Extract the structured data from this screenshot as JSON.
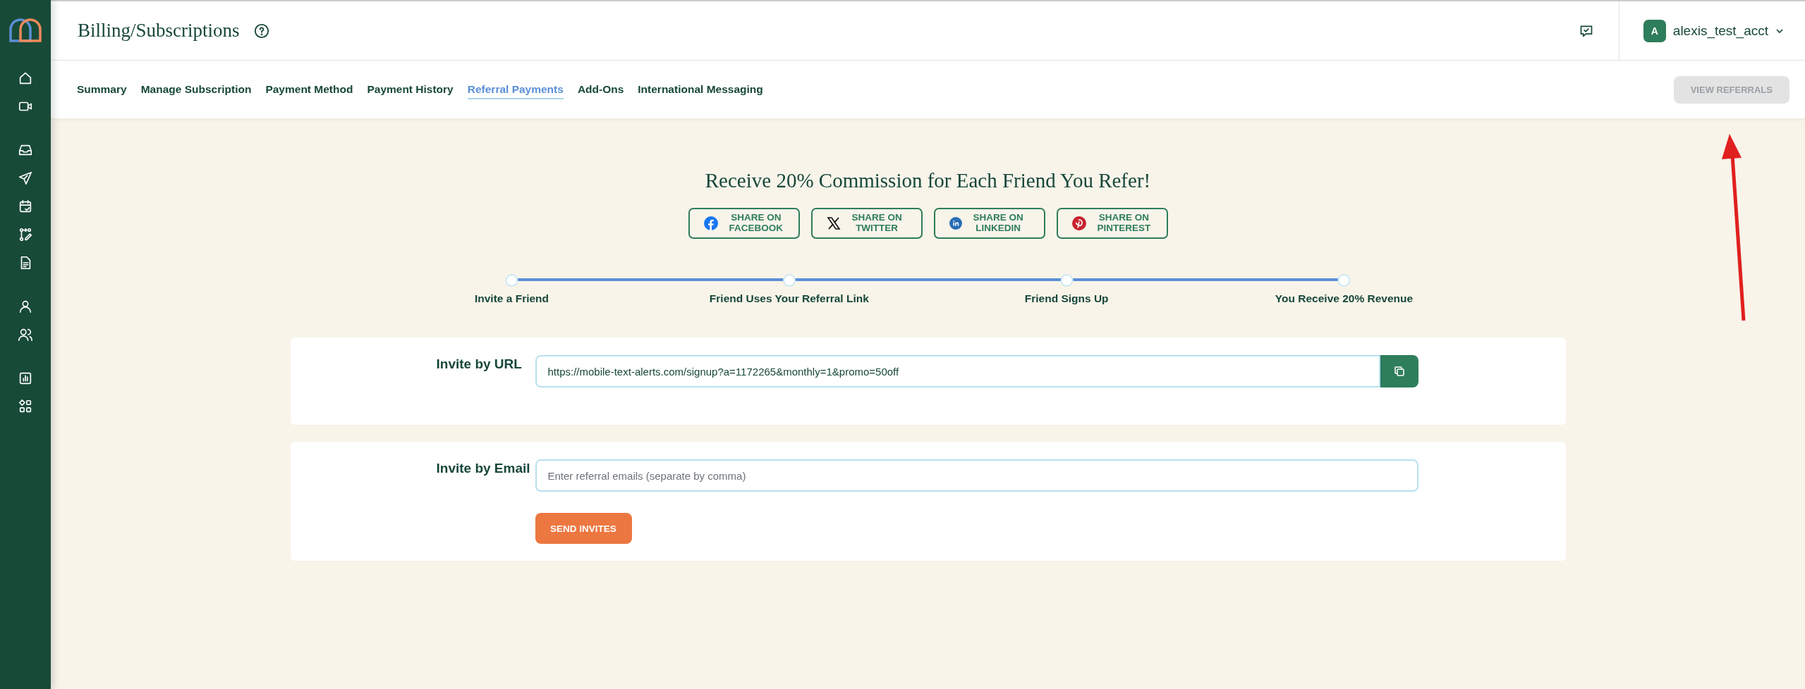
{
  "header": {
    "title": "Billing/Subscriptions",
    "account": {
      "initial": "A",
      "name": "alexis_test_acct"
    }
  },
  "tabs": [
    {
      "label": "Summary",
      "selected": false
    },
    {
      "label": "Manage Subscription",
      "selected": false
    },
    {
      "label": "Payment Method",
      "selected": false
    },
    {
      "label": "Payment History",
      "selected": false
    },
    {
      "label": "Referral Payments",
      "selected": true
    },
    {
      "label": "Add-Ons",
      "selected": false
    },
    {
      "label": "International Messaging",
      "selected": false
    }
  ],
  "view_referrals": {
    "label": "VIEW REFERRALS",
    "disabled": true
  },
  "headline": "Receive 20% Commission for Each Friend You Refer!",
  "share_buttons": [
    {
      "kind": "facebook",
      "line1": "SHARE ON",
      "line2": "FACEBOOK"
    },
    {
      "kind": "twitter",
      "line1": "SHARE ON",
      "line2": "TWITTER"
    },
    {
      "kind": "linkedin",
      "line1": "SHARE ON",
      "line2": "LINKEDIN"
    },
    {
      "kind": "pinterest",
      "line1": "SHARE ON",
      "line2": "PINTEREST"
    }
  ],
  "steps": [
    "Invite a Friend",
    "Friend Uses Your Referral Link",
    "Friend Signs Up",
    "You Receive 20% Revenue"
  ],
  "invite_url": {
    "label": "Invite by URL",
    "value": "https://mobile-text-alerts.com/signup?a=1172265&monthly=1&promo=50off"
  },
  "invite_email": {
    "label": "Invite by Email",
    "placeholder": "Enter referral emails (separate by comma)",
    "button": "SEND INVITES"
  }
}
